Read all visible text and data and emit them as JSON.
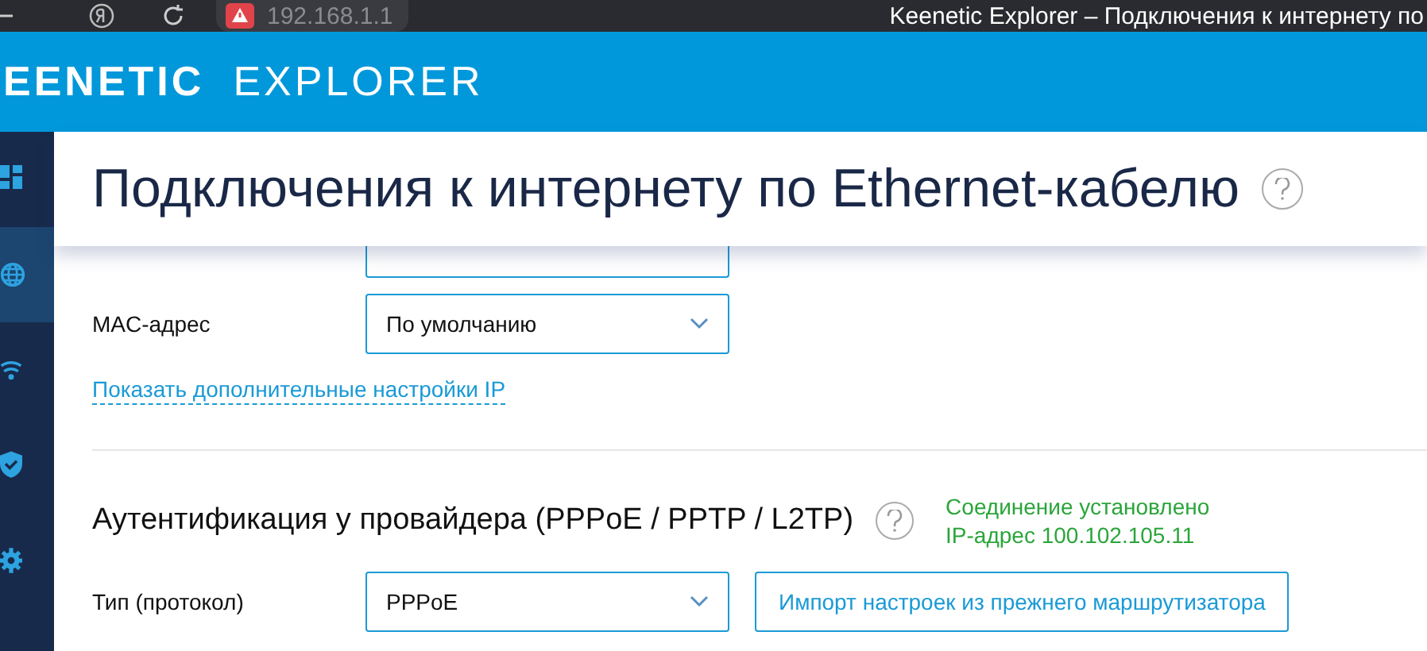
{
  "browser": {
    "address": "192.168.1.1",
    "tab_title": "Keenetic Explorer – Подключения к интернету по"
  },
  "header": {
    "logo": "EENETIC",
    "product": "EXPLORER"
  },
  "sidebar": {
    "items": [
      {
        "kind": "dashboard",
        "selected": false
      },
      {
        "kind": "globe",
        "selected": true
      },
      {
        "kind": "wifi",
        "selected": false
      },
      {
        "kind": "shield",
        "selected": false
      },
      {
        "kind": "gear",
        "selected": false
      }
    ]
  },
  "page": {
    "title": "Подключения к интернету по Ethernet-кабелю"
  },
  "ip_settings": {
    "rows": [
      {
        "label": "MAC-адрес",
        "value": "По умолчанию"
      }
    ],
    "link": "Показать дополнительные настройки IP"
  },
  "auth": {
    "title": "Аутентификация у провайдера (PPPoE / PPTP / L2TP)",
    "status": [
      "Соединение установлено",
      "IP-адрес 100.102.105.11"
    ],
    "rows": [
      {
        "label": "Тип (протокол)",
        "value": "PPPoE"
      }
    ],
    "import_button": "Импорт настроек из прежнего маршрутизатора"
  }
}
